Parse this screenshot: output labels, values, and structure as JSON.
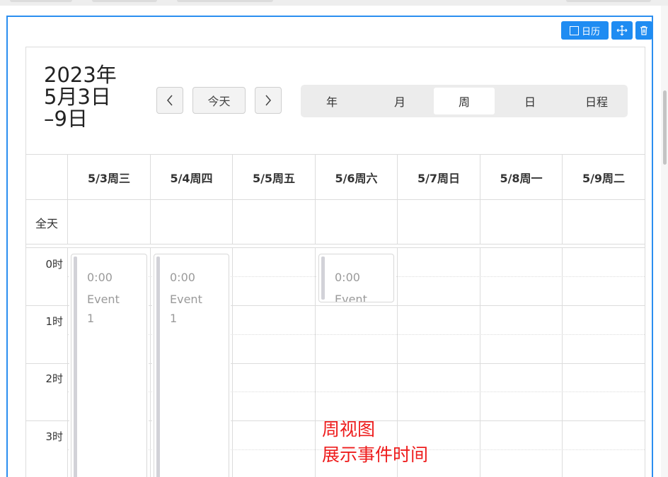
{
  "toolbar": {
    "calendar_label": "日历",
    "move_icon": "move-icon",
    "delete_icon": "trash-icon"
  },
  "calendar": {
    "title_lines": [
      "2023年",
      "5月3日",
      "–9日"
    ],
    "prev": "<",
    "today": "今天",
    "next": ">",
    "views": [
      "年",
      "月",
      "周",
      "日",
      "日程"
    ],
    "active_view": "周",
    "day_headers": [
      "5/3周三",
      "5/4周四",
      "5/5周五",
      "5/6周六",
      "5/7周日",
      "5/8周一",
      "5/9周二"
    ],
    "allday_label": "全天",
    "hours": [
      "0时",
      "1时",
      "2时",
      "3时"
    ],
    "events": [
      {
        "time": "0:00",
        "title": "Event 1"
      },
      {
        "time": "0:00",
        "title": "Event 1"
      },
      {
        "time": "0:00",
        "title": "Event"
      }
    ]
  },
  "annotation": {
    "line1": "周视图",
    "line2": "展示事件时间"
  },
  "colors": {
    "accent": "#1f8cf2",
    "annotation": "#ee1c1c"
  }
}
